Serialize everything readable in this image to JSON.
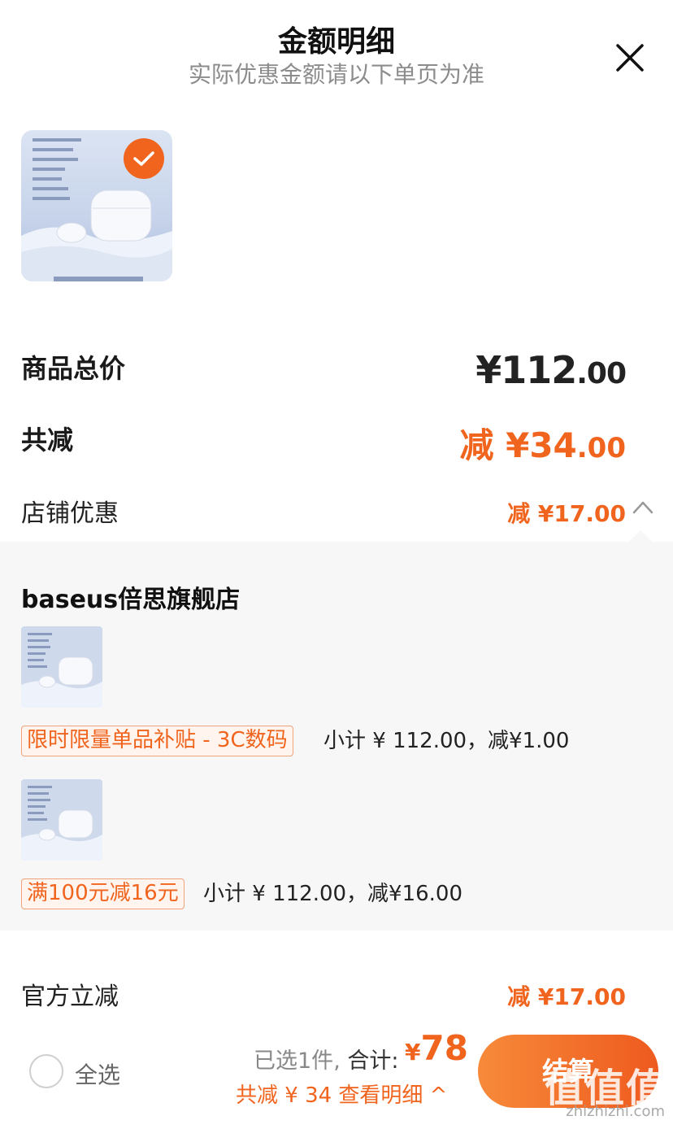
{
  "header": {
    "title": "金额明细",
    "subtitle": "实际优惠金额请以下单页为准"
  },
  "summary": {
    "total_label": "商品总价",
    "total_main": "¥112",
    "total_cents": ".00",
    "discount_label": "共减",
    "discount_main": "减 ¥34",
    "discount_cents": ".00"
  },
  "shop_discount": {
    "label": "店铺优惠",
    "value": "减 ¥17.00"
  },
  "store": {
    "name": "baseus倍思旗舰店",
    "promos": [
      {
        "tag": "限时限量单品补贴 - 3C数码",
        "detail": "小计 ¥ 112.00，减¥1.00"
      },
      {
        "tag": "满100元减16元",
        "detail": "小计 ¥ 112.00，减¥16.00"
      }
    ]
  },
  "official": {
    "label": "官方立减",
    "value": "减 ¥17.00"
  },
  "footer": {
    "select_all": "全选",
    "selected_count": "已选1件",
    "total_word": "合计:",
    "sum_yen": "¥",
    "sum_value": "78",
    "discount_summary": "共减 ¥ 34  查看明细 ^",
    "checkout_label": "结算"
  },
  "watermark": {
    "main": "值值值",
    "sub": "zhizhizhi.com"
  },
  "colors": {
    "accent": "#f0641e",
    "panel_bg": "#f7f7f7"
  }
}
